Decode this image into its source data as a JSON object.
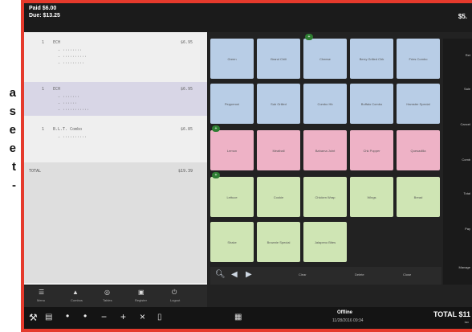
{
  "side_text": [
    "a",
    "s",
    "e",
    "e",
    "t",
    "-"
  ],
  "header": {
    "paid": "Paid $6.00",
    "due": "Due: $13.25",
    "amount": "$5."
  },
  "ticket": {
    "items": [
      {
        "qty": "1",
        "name": "ECH",
        "price": "$6.95"
      },
      {
        "qty": "1",
        "name": "ECH",
        "price": "$6.95"
      },
      {
        "qty": "1",
        "name": "B.L.T. Combo",
        "price": "$6.85"
      }
    ],
    "total_label": "TOTAL",
    "total_value": "$19.39"
  },
  "grid_buttons": [
    [
      "Green",
      "Brand Chili",
      "Cheese",
      "Berry Grilled Chk",
      "Fries Combo"
    ],
    [
      "Pepperoni",
      "Sub Grilled",
      "Combo Hb",
      "Buffalo Combo",
      "Hamster Special"
    ],
    [
      "Lemon",
      "Meatball",
      "Bahama Joint",
      "Chk Popper",
      "Quesadilla"
    ],
    [
      "Lettuce",
      "Cookie",
      "Chicken Wrap",
      "Wings",
      "Bread"
    ],
    [
      "Shake",
      "Brownie Special",
      "Jalapeno Bites"
    ]
  ],
  "strip": {
    "clear": "Clear",
    "delete": "Delete",
    "close": "Close"
  },
  "rail": [
    "Ret",
    "Sale",
    "Cancel",
    "Comb",
    "Total",
    "Pay",
    "Manage"
  ],
  "nav": [
    "Menu",
    "Combos",
    "Tables",
    "Register",
    "Logout"
  ],
  "status": {
    "mode": "Offline",
    "datetime": "11/28/2016 09:34",
    "total": "TOTAL $11",
    "tax": "tax"
  }
}
